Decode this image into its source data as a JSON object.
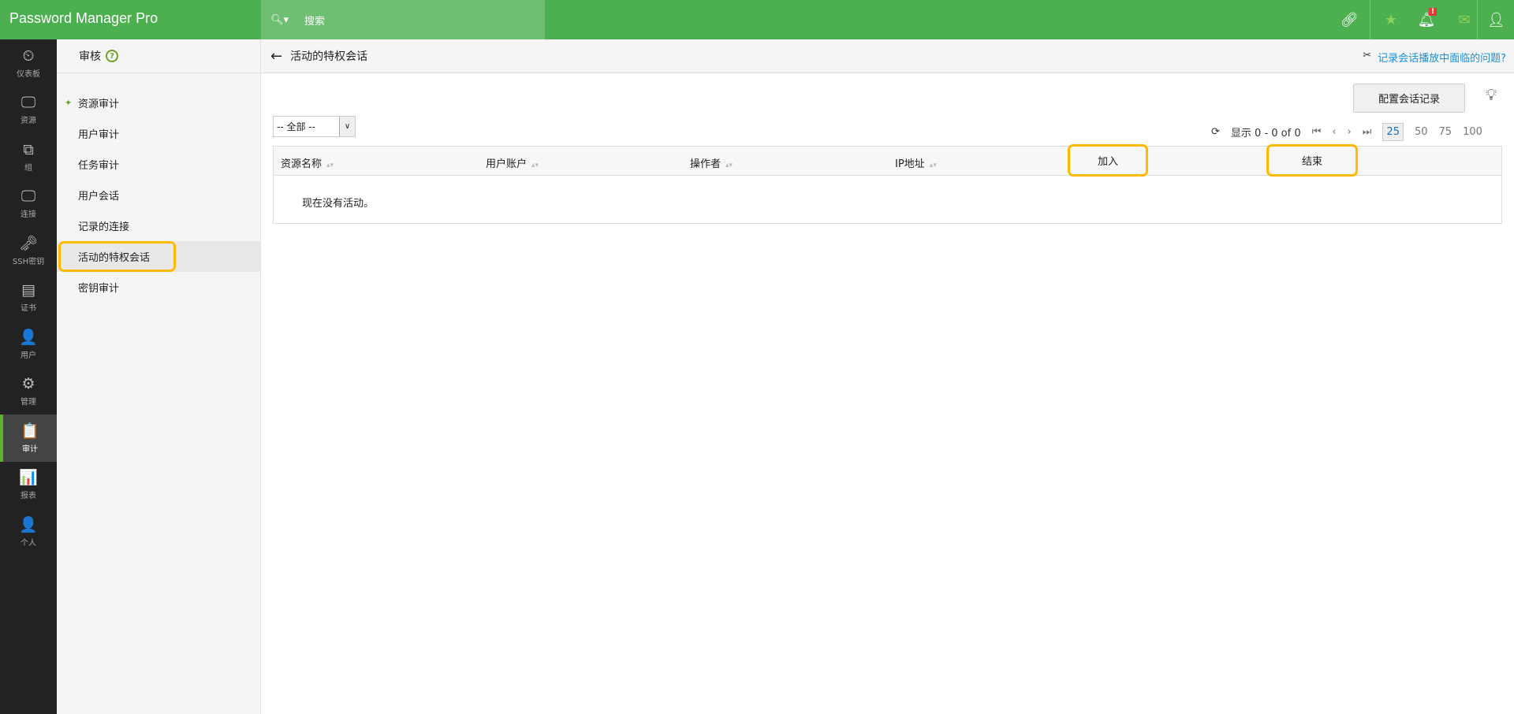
{
  "app": {
    "title": "Password Manager Pro",
    "search_placeholder": "搜索"
  },
  "topbar": {
    "icons": [
      "link-icon",
      "favorite-user-icon",
      "bell-icon",
      "mail-icon",
      "user-icon"
    ],
    "alert_badge": "!"
  },
  "nav": [
    {
      "label": "仪表板",
      "icon": "⏲"
    },
    {
      "label": "资源",
      "icon": "🖵"
    },
    {
      "label": "组",
      "icon": "⧉"
    },
    {
      "label": "连接",
      "icon": "🖵"
    },
    {
      "label": "SSH密钥",
      "icon": "🗝"
    },
    {
      "label": "证书",
      "icon": "▤"
    },
    {
      "label": "用户",
      "icon": "👤"
    },
    {
      "label": "管理",
      "icon": "⚙"
    },
    {
      "label": "审计",
      "icon": "📋"
    },
    {
      "label": "报表",
      "icon": "📊"
    },
    {
      "label": "个人",
      "icon": "👤"
    }
  ],
  "submenu": {
    "title": "审核",
    "items": [
      "资源审计",
      "用户审计",
      "任务审计",
      "用户会话",
      "记录的连接",
      "活动的特权会话",
      "密钥审计"
    ]
  },
  "main": {
    "title": "活动的特权会话",
    "help_link": "记录会话播放中面临的问题?",
    "configure_button": "配置会话记录",
    "filter": "-- 全部 --",
    "pagination": {
      "text": "显示 0 - 0 of 0",
      "sizes": [
        "25",
        "50",
        "75",
        "100"
      ]
    },
    "columns": [
      "资源名称",
      "用户账户",
      "操作者",
      "IP地址",
      "加入",
      "结束"
    ],
    "empty_message": "现在没有活动。"
  }
}
